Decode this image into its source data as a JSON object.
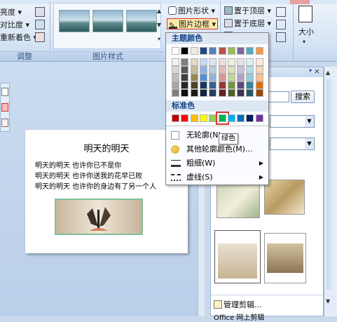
{
  "ribbon": {
    "adjust": {
      "items": [
        "亮度",
        "对比度",
        "重新着色"
      ],
      "label": "调整"
    },
    "styles": {
      "label": "图片样式"
    },
    "shape_label": "图片形状",
    "border_label": "图片边框",
    "bring_front": "置于顶层",
    "send_back": "置于底层",
    "size_label": "大小"
  },
  "slide": {
    "title": "明天的明天",
    "lines": [
      "明天的明天 也许你已不是你",
      "明天的明天 也许你送我的花早已败",
      "明天的明天 也许你的身边有了另一个人"
    ]
  },
  "taskpane": {
    "search_button": "搜索",
    "manage_link": "管理剪辑...",
    "bottom_link": "Office 网上剪辑"
  },
  "menu": {
    "theme_header": "主题颜色",
    "standard_header": "标准色",
    "tooltip": "绿色",
    "items": [
      {
        "label": "无轮廓(N)"
      },
      {
        "label": "其他轮廓颜色(M)..."
      },
      {
        "label": "粗细(W)"
      },
      {
        "label": "虚线(S)"
      }
    ],
    "theme_top": [
      "#ffffff",
      "#000000",
      "#eeece1",
      "#1f497d",
      "#4f81bd",
      "#c0504d",
      "#9bbb59",
      "#8064a2",
      "#4bacc6",
      "#f79646"
    ],
    "theme_shades": [
      [
        "#f2f2f2",
        "#7f7f7f",
        "#ddd9c3",
        "#c6d9f0",
        "#dbe5f1",
        "#f2dcdb",
        "#ebf1dd",
        "#e5e0ec",
        "#dbeef3",
        "#fdeada"
      ],
      [
        "#d8d8d8",
        "#595959",
        "#c4bd97",
        "#8db3e2",
        "#b8cce4",
        "#e5b9b7",
        "#d7e3bc",
        "#ccc1d9",
        "#b7dde8",
        "#fbd5b5"
      ],
      [
        "#bfbfbf",
        "#3f3f3f",
        "#938953",
        "#548dd4",
        "#95b3d7",
        "#d99694",
        "#c3d69b",
        "#b2a2c7",
        "#92cddc",
        "#fac08f"
      ],
      [
        "#a5a5a5",
        "#262626",
        "#494429",
        "#17365d",
        "#366092",
        "#953734",
        "#76923c",
        "#5f497a",
        "#31859b",
        "#e36c09"
      ],
      [
        "#7f7f7f",
        "#0c0c0c",
        "#1d1b10",
        "#0f243e",
        "#244061",
        "#632423",
        "#4f6128",
        "#3f3151",
        "#205867",
        "#974806"
      ]
    ],
    "standard": [
      "#c00000",
      "#ff0000",
      "#ffc000",
      "#ffff00",
      "#92d050",
      "#00b050",
      "#00b0f0",
      "#0070c0",
      "#002060",
      "#7030a0"
    ]
  }
}
